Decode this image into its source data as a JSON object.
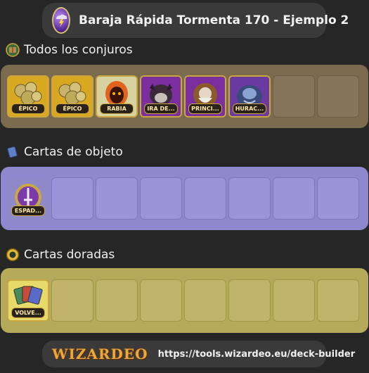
{
  "header": {
    "title": "Baraja Rápida Tormenta 170 - Ejemplo 2",
    "icon": "storm-school-icon"
  },
  "sections": {
    "spells": {
      "title": "Todos los conjuros",
      "icon": "spellbook-icon",
      "color": "#7a6a4e",
      "cards": [
        {
          "label": "ÉPICO",
          "icon": "epic-gold-rock-icon"
        },
        {
          "label": "ÉPICO",
          "icon": "epic-gold-rock-icon"
        },
        {
          "label": "RABIA",
          "icon": "rage-fire-face-icon"
        },
        {
          "label": "IRA DE...",
          "icon": "wrath-creature-icon"
        },
        {
          "label": "PRINCI...",
          "icon": "prince-storm-figure-icon"
        },
        {
          "label": "HURAC...",
          "icon": "hurricane-cloud-icon"
        }
      ],
      "empty_slots": 2
    },
    "items": {
      "title": "Cartas de objeto",
      "icon": "item-card-icon",
      "color": "#8f88cf",
      "cards": [
        {
          "label": "ESPAD...",
          "icon": "sword-medallion-icon"
        }
      ],
      "empty_slots": 7
    },
    "gold": {
      "title": "Cartas doradas",
      "icon": "gold-coin-icon",
      "color": "#b5aa5a",
      "cards": [
        {
          "label": "VOLVE...",
          "icon": "card-deck-icon"
        }
      ],
      "empty_slots": 7
    }
  },
  "footer": {
    "logo_text": "WIZARDEO",
    "url": "https://tools.wizardeo.eu/deck-builder"
  }
}
